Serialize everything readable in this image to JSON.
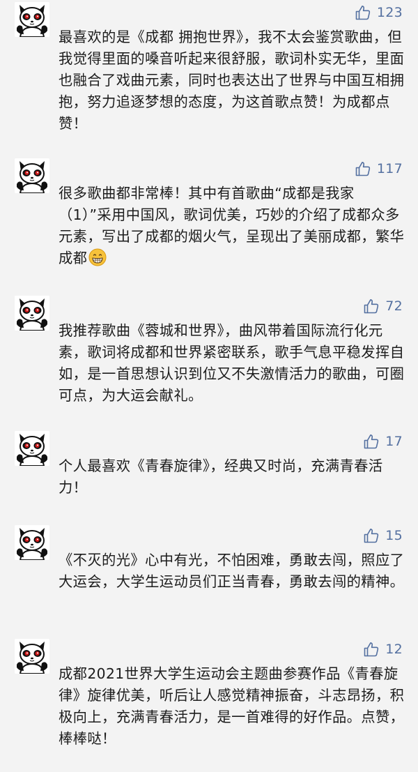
{
  "comments": [
    {
      "likes": "123",
      "text": "最喜欢的是《成都 拥抱世界》，我不太会鉴赏歌曲，但我觉得里面的嗓音听起来很舒服，歌词朴实无华，里面也融合了戏曲元素，同时也表达出了世界与中国互相拥抱，努力追逐梦想的态度，为这首歌点赞！为成都点赞！",
      "avatar_icon": "panda-avatar-icon",
      "like_icon": "thumbs-up-icon"
    },
    {
      "likes": "117",
      "text": "很多歌曲都非常棒！其中有首歌曲“成都是我家（1）”采用中国风，歌词优美，巧妙的介绍了成都众多元素，写出了成都的烟火气，呈现出了美丽成都，繁华成都",
      "emoji": "grinning-face-emoji",
      "avatar_icon": "panda-avatar-icon",
      "like_icon": "thumbs-up-icon"
    },
    {
      "likes": "72",
      "text": "我推荐歌曲《蓉城和世界》，曲风带着国际流行化元素，歌词将成都和世界紧密联系，歌手气息平稳发挥自如，是一首思想认识到位又不失激情活力的歌曲，可圈可点，为大运会献礼。",
      "avatar_icon": "panda-avatar-icon",
      "like_icon": "thumbs-up-icon"
    },
    {
      "likes": "17",
      "text": "个人最喜欢《青春旋律》，经典又时尚，充满青春活力！",
      "avatar_icon": "panda-avatar-icon",
      "like_icon": "thumbs-up-icon"
    },
    {
      "likes": "15",
      "text": "《不灭的光》心中有光，不怕困难，勇敢去闯，照应了大运会，大学生运动员们正当青春，勇敢去闯的精神。",
      "avatar_icon": "panda-avatar-icon",
      "like_icon": "thumbs-up-icon"
    },
    {
      "likes": "12",
      "text": "成都2021世界大学生运动会主题曲参赛作品《青春旋律》旋律优美，听后让人感觉精神振奋，斗志昂扬，积极向上，充满青春活力，是一首难得的好作品。点赞， 棒棒哒！",
      "avatar_icon": "panda-avatar-icon",
      "like_icon": "thumbs-up-icon"
    }
  ],
  "colors": {
    "background": "#f3f3f3",
    "like_blue": "#5470a0",
    "text": "#1c1c1c",
    "panda_red": "#d11b1b"
  }
}
